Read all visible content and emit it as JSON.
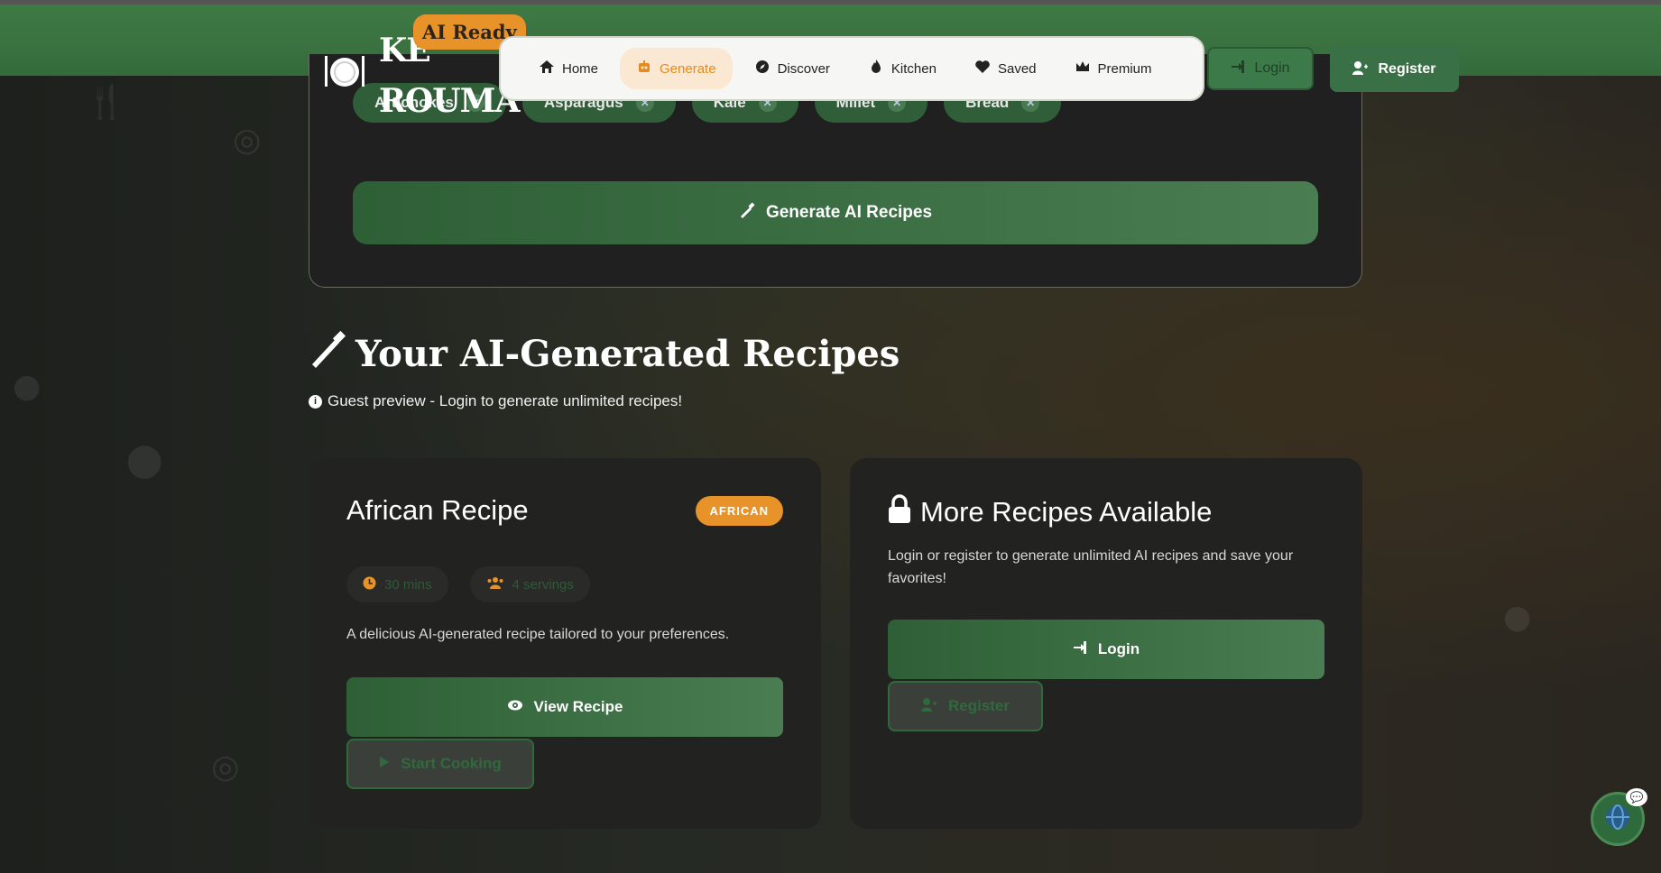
{
  "brand": {
    "name_line1": "KE",
    "name_line2": "ROUMA",
    "badge": "AI Ready"
  },
  "nav": {
    "items": [
      {
        "label": "Home",
        "icon": "home-icon",
        "active": false
      },
      {
        "label": "Generate",
        "icon": "robot-icon",
        "active": true
      },
      {
        "label": "Discover",
        "icon": "compass-icon",
        "active": false
      },
      {
        "label": "Kitchen",
        "icon": "fire-icon",
        "active": false
      },
      {
        "label": "Saved",
        "icon": "heart-icon",
        "active": false
      },
      {
        "label": "Premium",
        "icon": "crown-icon",
        "active": false
      }
    ],
    "login_label": "Login",
    "register_label": "Register"
  },
  "ingredients": {
    "chips": [
      "Artichokes",
      "Asparagus",
      "Kale",
      "Millet",
      "Bread"
    ],
    "generate_label": "Generate AI Recipes"
  },
  "results": {
    "title": "Your AI-Generated Recipes",
    "guest_note": "Guest preview - Login to generate unlimited recipes!"
  },
  "recipe_card": {
    "title": "African Recipe",
    "cuisine": "AFRICAN",
    "time": "30 mins",
    "servings": "4 servings",
    "description": "A delicious AI-generated recipe tailored to your preferences.",
    "view_label": "View Recipe",
    "start_label": "Start Cooking"
  },
  "more_card": {
    "title": "More Recipes Available",
    "description": "Login or register to generate unlimited AI recipes and save your favorites!",
    "login_label": "Login",
    "register_label": "Register"
  },
  "colors": {
    "primary_green": "#3a7045",
    "accent_orange": "#e8922a",
    "background": "#232622"
  }
}
